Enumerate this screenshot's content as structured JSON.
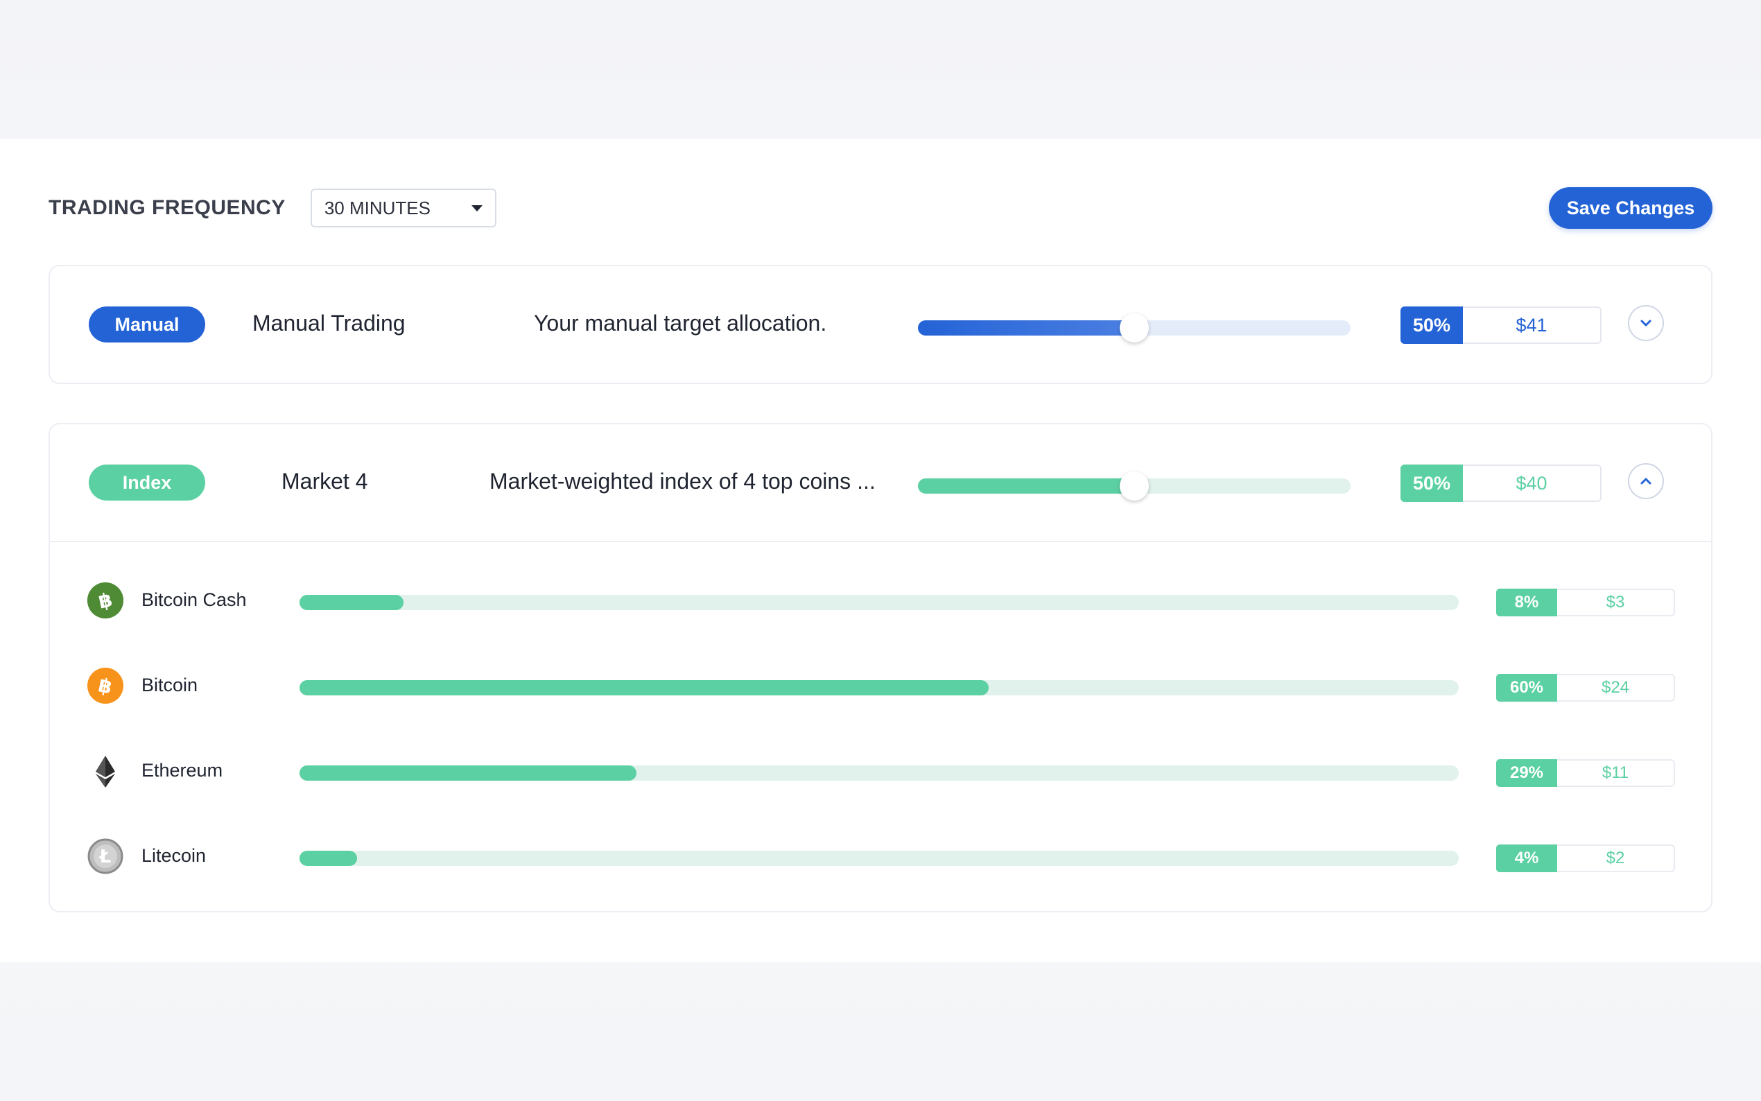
{
  "frequency": {
    "label": "TRADING FREQUENCY",
    "selected": "30 MINUTES"
  },
  "save_label": "Save Changes",
  "colors": {
    "blue": "#2463d6",
    "green": "#5bd0a2"
  },
  "strategies": [
    {
      "badge": "Manual",
      "name": "Manual Trading",
      "description": "Your manual target allocation.",
      "percent": "50%",
      "amount": "$41",
      "slider_fraction": 0.5,
      "expanded": false
    },
    {
      "badge": "Index",
      "name": "Market 4",
      "description": "Market-weighted index of 4 top coins ...",
      "percent": "50%",
      "amount": "$40",
      "slider_fraction": 0.5,
      "expanded": true
    }
  ],
  "coins": [
    {
      "name": "Bitcoin Cash",
      "icon": "bitcoin-cash-icon",
      "percent": "8%",
      "amount": "$3",
      "fraction": 0.08
    },
    {
      "name": "Bitcoin",
      "icon": "bitcoin-icon",
      "percent": "60%",
      "amount": "$24",
      "fraction": 0.6
    },
    {
      "name": "Ethereum",
      "icon": "ethereum-icon",
      "percent": "29%",
      "amount": "$11",
      "fraction": 0.29
    },
    {
      "name": "Litecoin",
      "icon": "litecoin-icon",
      "percent": "4%",
      "amount": "$2",
      "fraction": 0.04
    }
  ]
}
